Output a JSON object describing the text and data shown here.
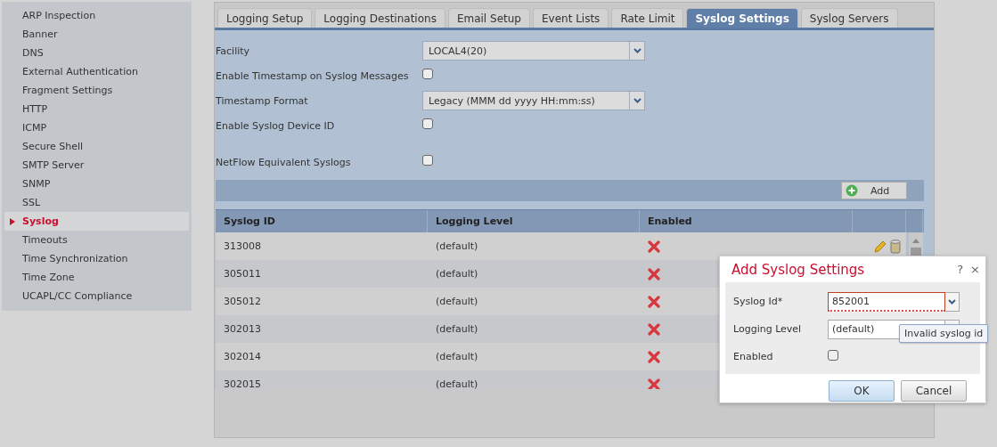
{
  "sidebar": {
    "items": [
      {
        "label": "ARP Inspection",
        "selected": false
      },
      {
        "label": "Banner",
        "selected": false
      },
      {
        "label": "DNS",
        "selected": false
      },
      {
        "label": "External Authentication",
        "selected": false
      },
      {
        "label": "Fragment Settings",
        "selected": false
      },
      {
        "label": "HTTP",
        "selected": false
      },
      {
        "label": "ICMP",
        "selected": false
      },
      {
        "label": "Secure Shell",
        "selected": false
      },
      {
        "label": "SMTP Server",
        "selected": false
      },
      {
        "label": "SNMP",
        "selected": false
      },
      {
        "label": "SSL",
        "selected": false
      },
      {
        "label": "Syslog",
        "selected": true
      },
      {
        "label": "Timeouts",
        "selected": false
      },
      {
        "label": "Time Synchronization",
        "selected": false
      },
      {
        "label": "Time Zone",
        "selected": false
      },
      {
        "label": "UCAPL/CC Compliance",
        "selected": false
      }
    ]
  },
  "tabs": [
    {
      "label": "Logging Setup",
      "selected": false
    },
    {
      "label": "Logging Destinations",
      "selected": false
    },
    {
      "label": "Email Setup",
      "selected": false
    },
    {
      "label": "Event Lists",
      "selected": false
    },
    {
      "label": "Rate Limit",
      "selected": false
    },
    {
      "label": "Syslog Settings",
      "selected": true
    },
    {
      "label": "Syslog Servers",
      "selected": false
    }
  ],
  "form": {
    "fields": [
      {
        "kind": "select",
        "label": "Facility",
        "value": "LOCAL4(20)"
      },
      {
        "kind": "checkbox",
        "label": "Enable Timestamp on Syslog Messages",
        "checked": false
      },
      {
        "kind": "select",
        "label": "Timestamp Format",
        "value": "Legacy (MMM dd yyyy HH:mm:ss)"
      },
      {
        "kind": "checkbox",
        "label": "Enable Syslog Device ID",
        "checked": false
      },
      {
        "kind": "checkbox",
        "label": "NetFlow Equivalent Syslogs",
        "checked": false
      }
    ]
  },
  "table": {
    "add_button": "Add",
    "columns": [
      "Syslog ID",
      "Logging Level",
      "Enabled"
    ],
    "rows": [
      {
        "syslog_id": "313008",
        "logging_level": "(default)",
        "enabled": false,
        "hovered": true
      },
      {
        "syslog_id": "305011",
        "logging_level": "(default)",
        "enabled": false
      },
      {
        "syslog_id": "305012",
        "logging_level": "(default)",
        "enabled": false
      },
      {
        "syslog_id": "302013",
        "logging_level": "(default)",
        "enabled": false
      },
      {
        "syslog_id": "302014",
        "logging_level": "(default)",
        "enabled": false
      },
      {
        "syslog_id": "302015",
        "logging_level": "(default)",
        "enabled": false
      }
    ]
  },
  "dialog": {
    "title": "Add Syslog Settings",
    "help": "?",
    "close": "×",
    "fields": [
      {
        "kind": "combo",
        "label": "Syslog Id*",
        "value": "852001",
        "invalid": true
      },
      {
        "kind": "combo",
        "label": "Logging Level",
        "value": "(default)",
        "invalid": false
      },
      {
        "kind": "checkbox",
        "label": "Enabled",
        "checked": false
      }
    ],
    "tooltip": "Invalid syslog id",
    "buttons": [
      {
        "label": "OK",
        "primary": true
      },
      {
        "label": "Cancel",
        "primary": false
      }
    ]
  }
}
